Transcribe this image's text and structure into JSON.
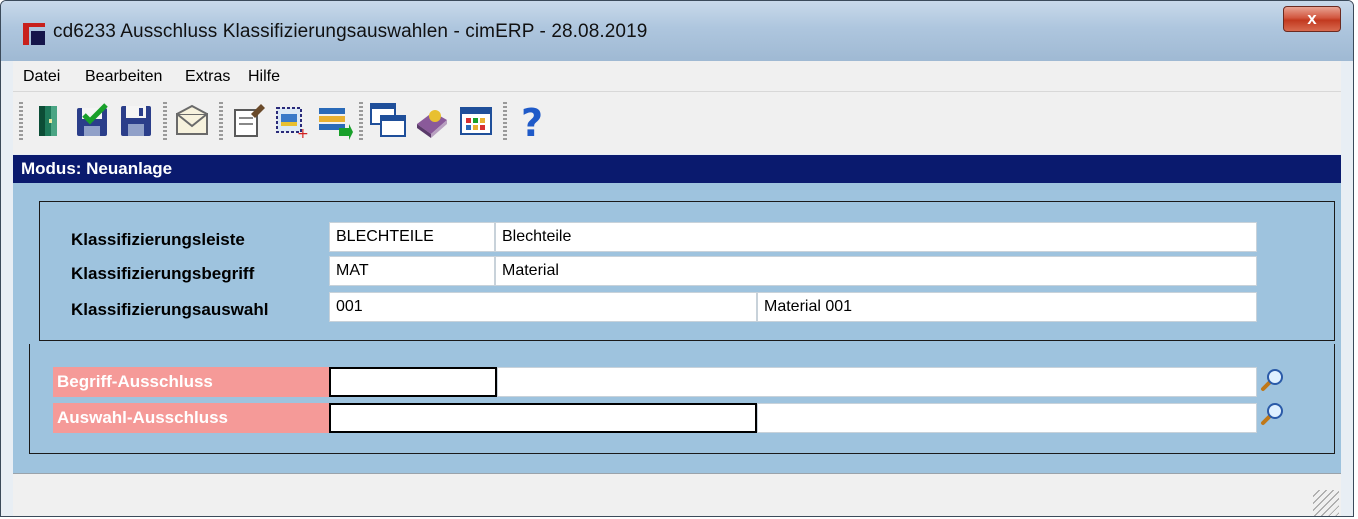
{
  "window": {
    "title": "cd6233 Ausschluss Klassifizierungsauswahlen - cimERP - 28.08.2019",
    "close_label": "x"
  },
  "menu": [
    {
      "label": "Datei"
    },
    {
      "label": "Bearbeiten"
    },
    {
      "label": "Extras"
    },
    {
      "label": "Hilfe"
    }
  ],
  "toolbar": [
    {
      "icon": "exit-door-icon"
    },
    {
      "icon": "save-check-icon"
    },
    {
      "icon": "save-disk-icon"
    },
    {
      "icon": "mail-envelope-icon"
    },
    {
      "icon": "edit-document-icon"
    },
    {
      "icon": "new-record-icon"
    },
    {
      "icon": "list-transfer-icon"
    },
    {
      "icon": "windows-cascade-icon"
    },
    {
      "icon": "book-icon"
    },
    {
      "icon": "table-grid-icon"
    },
    {
      "icon": "help-question-icon"
    }
  ],
  "mode": "Modus: Neuanlage",
  "form": {
    "rows": [
      {
        "label": "Klassifizierungsleiste",
        "code": "BLECHTEILE",
        "text": "Blechteile"
      },
      {
        "label": "Klassifizierungsbegriff",
        "code": "MAT",
        "text": "Material"
      },
      {
        "label": "Klassifizierungsauswahl",
        "code": "001",
        "text": "Material 001"
      }
    ],
    "exclusions": [
      {
        "label": "Begriff-Ausschluss",
        "code": "",
        "text": ""
      },
      {
        "label": "Auswahl-Ausschluss",
        "code": "",
        "text": ""
      }
    ]
  },
  "colors": {
    "mode_bar": "#0a1a6e",
    "content_bg": "#9ec3de",
    "exclusion_label_bg": "#f59a98",
    "close_button": "#c2391f"
  }
}
